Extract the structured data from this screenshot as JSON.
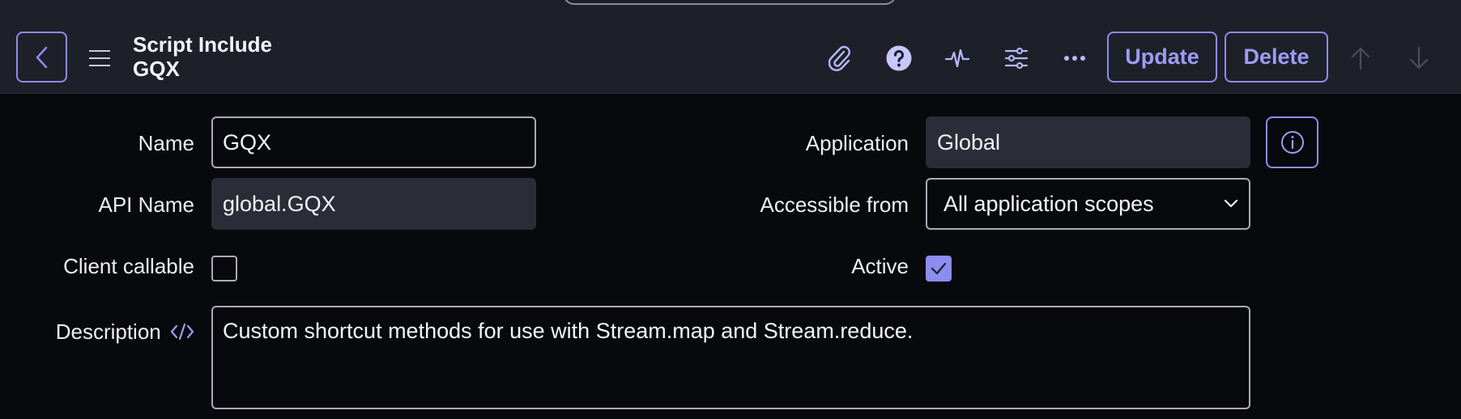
{
  "header": {
    "record_type": "Script Include",
    "record_name": "GQX",
    "buttons": {
      "update": "Update",
      "delete": "Delete"
    },
    "icons": [
      "back-icon",
      "menu-icon",
      "paperclip-icon",
      "help-icon",
      "activity-icon",
      "settings-sliders-icon",
      "more-icon",
      "arrow-up-icon",
      "arrow-down-icon"
    ]
  },
  "form": {
    "name": {
      "label": "Name",
      "value": "GQX"
    },
    "api_name": {
      "label": "API Name",
      "value": "global.GQX"
    },
    "client_callable": {
      "label": "Client callable",
      "checked": false
    },
    "application": {
      "label": "Application",
      "value": "Global"
    },
    "accessible_from": {
      "label": "Accessible from",
      "value": "All application scopes"
    },
    "active": {
      "label": "Active",
      "checked": true
    },
    "description": {
      "label": "Description",
      "value": "Custom shortcut methods for use with Stream.map and Stream.reduce."
    }
  },
  "colors": {
    "accent": "#8d8cf0",
    "header_bg": "#1e2029",
    "page_bg": "#08090c",
    "readonly_bg": "#2a2d37"
  }
}
